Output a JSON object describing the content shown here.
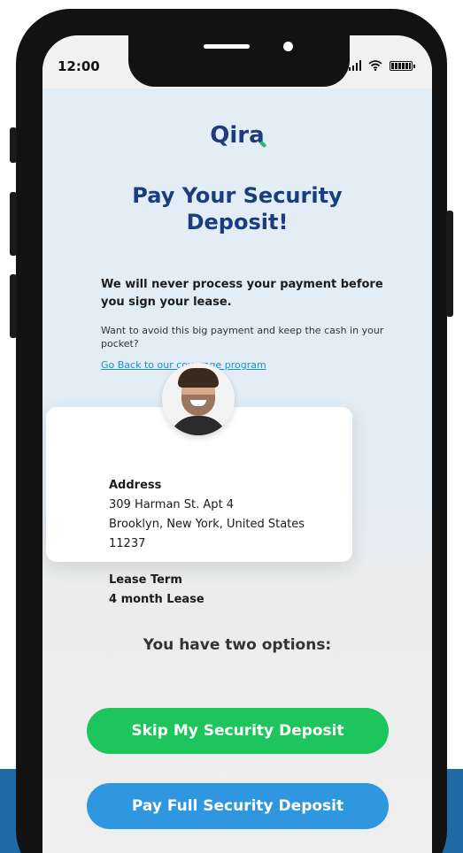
{
  "status_bar": {
    "time": "12:00"
  },
  "logo": {
    "text": "Qira"
  },
  "title": "Pay Your Security Deposit!",
  "notice": "We will never process your payment before you sign your lease.",
  "sub_text": "Want to avoid this big payment and keep the cash in your pocket?",
  "link_text": "Go Back to our coverage program",
  "card": {
    "address_label": "Address",
    "address_line1": "309 Harman St. Apt 4",
    "address_line2": "Brooklyn, New York, United States",
    "address_line3": "11237",
    "lease_label": "Lease Term",
    "lease_value": "4 month Lease"
  },
  "options_heading": "You have two options:",
  "buttons": {
    "skip": "Skip My Security Deposit",
    "pay": "Pay Full Security Deposit"
  },
  "colors": {
    "brand_navy": "#1a3d80",
    "accent_green": "#1dc55d",
    "accent_blue": "#2e97e0",
    "link": "#1a8fd8"
  }
}
